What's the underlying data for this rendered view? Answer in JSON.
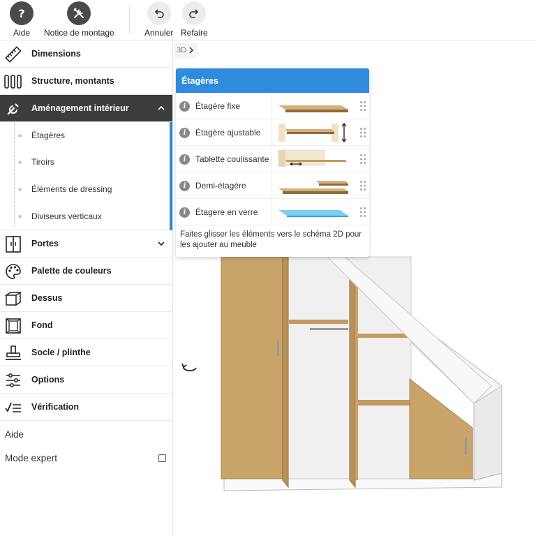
{
  "toolbar": {
    "help": {
      "label": "Aide",
      "icon": "question-icon"
    },
    "manual": {
      "label": "Notice de montage",
      "icon": "tools-icon"
    },
    "undo": {
      "label": "Annuler",
      "icon": "undo-icon"
    },
    "redo": {
      "label": "Refaire",
      "icon": "redo-icon"
    }
  },
  "sidebar": {
    "items": [
      {
        "label": "Dimensions",
        "icon": "ruler-icon"
      },
      {
        "label": "Structure, montants",
        "icon": "uprights-icon"
      },
      {
        "label": "Aménagement intérieur",
        "icon": "wrench-icon",
        "expanded": true
      },
      {
        "label": "Portes",
        "icon": "doors-icon"
      },
      {
        "label": "Palette de couleurs",
        "icon": "palette-icon"
      },
      {
        "label": "Dessus",
        "icon": "top-icon"
      },
      {
        "label": "Fond",
        "icon": "back-panel-icon"
      },
      {
        "label": "Socle / plinthe",
        "icon": "base-icon"
      },
      {
        "label": "Options",
        "icon": "sliders-icon"
      },
      {
        "label": "Vérification",
        "icon": "checklist-icon"
      }
    ],
    "subitems": [
      "Étagères",
      "Tiroirs",
      "Éléments de dressing",
      "Diviseurs verticaux"
    ],
    "help_label": "Aide",
    "expert_label": "Mode expert",
    "expert_checked": false
  },
  "main": {
    "view_label": "3D"
  },
  "panel": {
    "title": "Étagères",
    "rows": [
      {
        "label": "Étagère fixe",
        "thumb": "fixed-shelf"
      },
      {
        "label": "Étagère ajustable",
        "thumb": "adjustable-shelf"
      },
      {
        "label": "Tablette coulissante",
        "thumb": "sliding-shelf"
      },
      {
        "label": "Demi-étagère",
        "thumb": "half-shelf"
      },
      {
        "label": "Étagere en verre",
        "thumb": "glass-shelf"
      }
    ],
    "footer": "Faites glisser les éléments vers le schéma 2D pour les ajouter au meuble"
  },
  "colors": {
    "accent": "#2e8bdd",
    "active_menu": "#3d3d3d",
    "wood": "#c9a46a",
    "glass": "#6ec4f2"
  }
}
